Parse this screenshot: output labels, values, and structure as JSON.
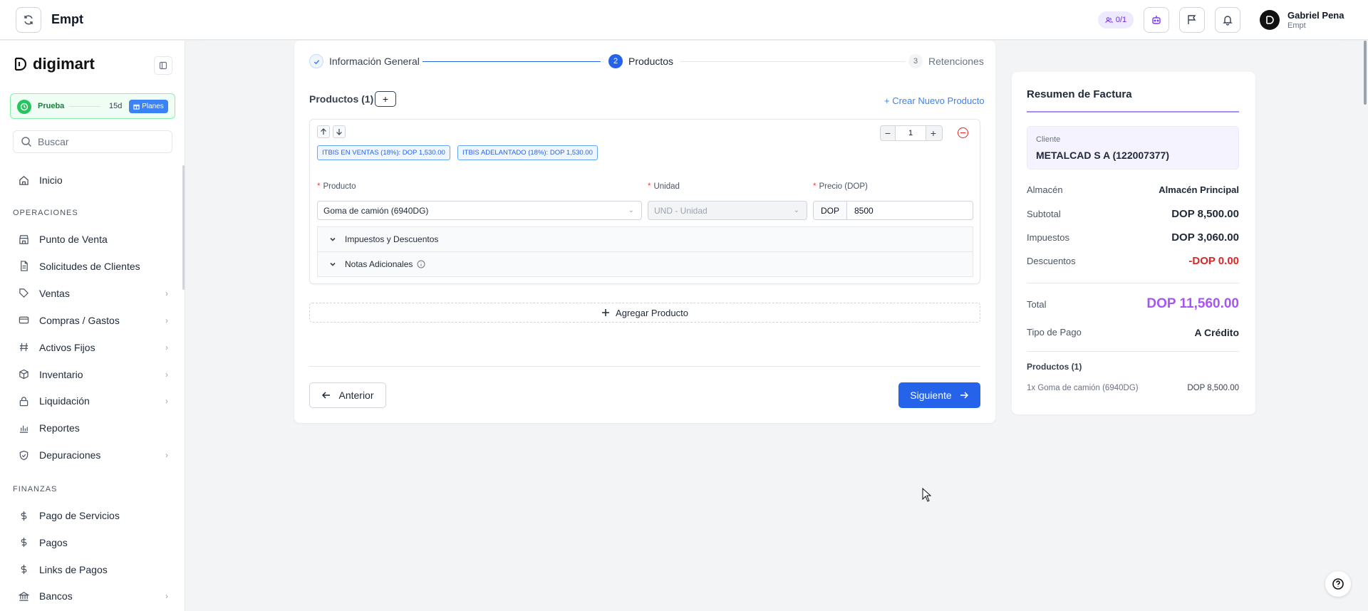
{
  "topbar": {
    "app_title": "Empt",
    "users_count": "0/1",
    "user_name": "Gabriel Pena",
    "user_org": "Empt"
  },
  "sidebar": {
    "brand": "digimart",
    "trial": {
      "label": "Prueba",
      "days": "15d",
      "plans_label": "Planes"
    },
    "search_placeholder": "Buscar",
    "home": "Inicio",
    "section_operations": "OPERACIONES",
    "operations": [
      {
        "label": "Punto de Venta",
        "icon": "store-icon"
      },
      {
        "label": "Solicitudes de Clientes",
        "icon": "document-icon"
      },
      {
        "label": "Ventas",
        "icon": "tag-icon"
      },
      {
        "label": "Compras / Gastos",
        "icon": "credit-card-icon"
      },
      {
        "label": "Activos Fijos",
        "icon": "hash-icon"
      },
      {
        "label": "Inventario",
        "icon": "box-icon"
      },
      {
        "label": "Liquidación",
        "icon": "lock-icon"
      },
      {
        "label": "Reportes",
        "icon": "chart-icon"
      },
      {
        "label": "Depuraciones",
        "icon": "shield-check-icon"
      }
    ],
    "section_finance": "FINANZAS",
    "finance": [
      {
        "label": "Pago de Servicios",
        "icon": "dollar-icon"
      },
      {
        "label": "Pagos",
        "icon": "dollar-icon"
      },
      {
        "label": "Links de Pagos",
        "icon": "dollar-icon"
      },
      {
        "label": "Bancos",
        "icon": "bank-icon"
      }
    ]
  },
  "stepper": {
    "step1": "Información General",
    "step2_number": "2",
    "step2": "Productos",
    "step3_number": "3",
    "step3": "Retenciones"
  },
  "products": {
    "title": "Productos (1)",
    "add_symbol": "+",
    "create_link": "+ Crear Nuevo Producto",
    "quantity": "1",
    "tags": [
      "ITBIS EN VENTAS (18%): DOP 1,530.00",
      "ITBIS ADELANTADO (18%): DOP 1,530.00"
    ],
    "product_label": "Producto",
    "unit_label": "Unidad",
    "price_label": "Precio (DOP)",
    "product_value": "Goma de camión (6940DG)",
    "unit_value": "UND - Unidad",
    "price_prefix": "DOP",
    "price_value": "8500",
    "taxes_section": "Impuestos y Descuentos",
    "notes_section": "Notas Adicionales",
    "add_product": "Agregar Producto",
    "prev_button": "Anterior",
    "next_button": "Siguiente"
  },
  "summary": {
    "title": "Resumen de Factura",
    "client_label": "Cliente",
    "client_name": "METALCAD S A (122007377)",
    "warehouse_label": "Almacén",
    "warehouse_value": "Almacén Principal",
    "subtotal_label": "Subtotal",
    "subtotal_value": "DOP 8,500.00",
    "taxes_label": "Impuestos",
    "taxes_value": "DOP 3,060.00",
    "discounts_label": "Descuentos",
    "discounts_value": "-DOP 0.00",
    "total_label": "Total",
    "total_value": "DOP 11,560.00",
    "payment_label": "Tipo de Pago",
    "payment_value": "A Crédito",
    "products_label": "Productos (1)",
    "line_item": "1x Goma de camión (6940DG)",
    "line_value": "DOP 8,500.00"
  },
  "colors": {
    "accent_blue": "#2563eb",
    "total_purple": "#a855f7",
    "discount_red": "#dc2626",
    "trial_green": "#22c55e"
  }
}
